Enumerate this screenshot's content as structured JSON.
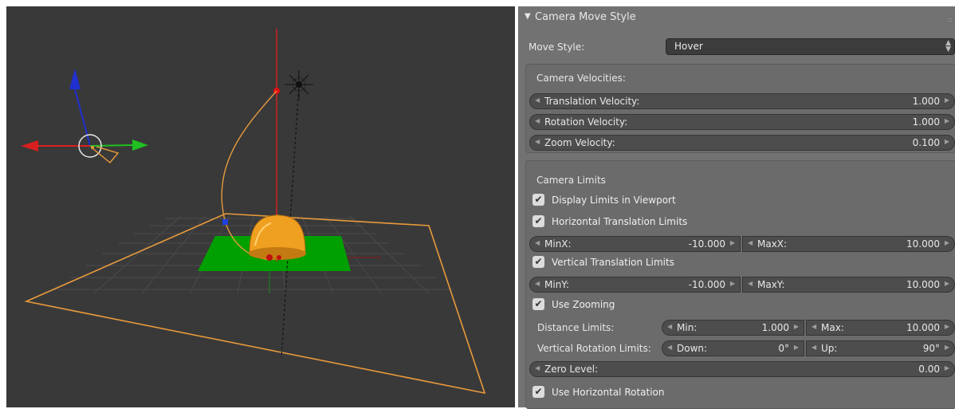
{
  "panel": {
    "header_title": "Camera Move Style",
    "move_style_label": "Move Style:",
    "move_style_value": "Hover",
    "velocities": {
      "title": "Camera Velocities:",
      "fields": [
        {
          "label": "Translation Velocity:",
          "value": "1.000"
        },
        {
          "label": "Rotation Velocity:",
          "value": "1.000"
        },
        {
          "label": "Zoom Velocity:",
          "value": "0.100"
        }
      ]
    },
    "limits": {
      "title": "Camera Limits",
      "display_limits": "Display Limits in Viewport",
      "horizontal_limits": "Horizontal Translation Limits",
      "minx_label": "MinX:",
      "minx_value": "-10.000",
      "maxx_label": "MaxX:",
      "maxx_value": "10.000",
      "vertical_limits": "Vertical Translation Limits",
      "miny_label": "MinY:",
      "miny_value": "-10.000",
      "maxy_label": "MaxY:",
      "maxy_value": "10.000",
      "use_zooming": "Use Zooming",
      "distance_label": "Distance Limits:",
      "min_label": "Min:",
      "min_value": "1.000",
      "max_label": "Max:",
      "max_value": "10.000",
      "vrot_label": "Vertical Rotation Limits:",
      "down_label": "Down:",
      "down_value": "0°",
      "up_label": "Up:",
      "up_value": "90°",
      "zero_label": "Zero Level:",
      "zero_value": "0.00",
      "use_horizontal_rotation": "Use Horizontal Rotation"
    }
  },
  "viewport": {
    "background": "#393939",
    "plane_color": "#00a000",
    "object_color": "#f0a020",
    "boundary_color": "#e89a3c",
    "axis_x_color": "#d82020",
    "axis_y_color": "#20c020",
    "axis_z_color": "#2030d0"
  },
  "icons": {
    "collapse": "triangle-down-icon",
    "checkbox": "checkmark-icon",
    "arrows": "chevron-left-right-icons"
  }
}
